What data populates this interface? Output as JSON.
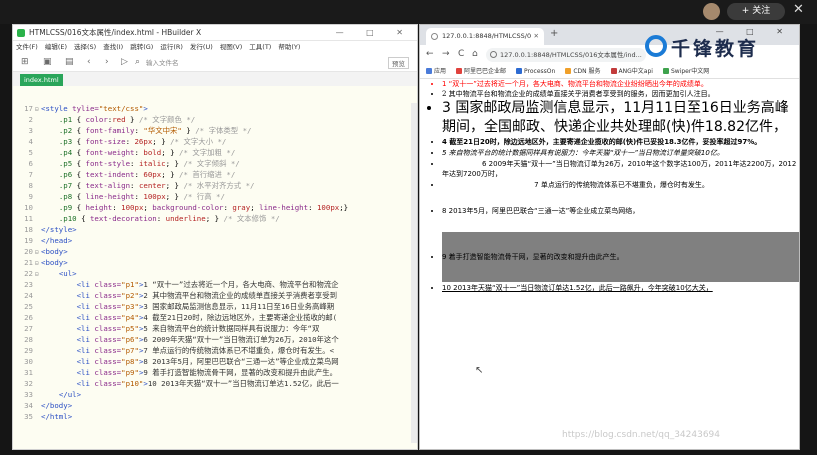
{
  "topbar": {
    "follow_label": "+ 关注",
    "close_glyph": "✕"
  },
  "editor": {
    "title": "HTMLCSS/016文本属性/index.html - HBuilder X",
    "window_controls": "— □ ✕",
    "menu": [
      "文件(F)",
      "编辑(E)",
      "选择(S)",
      "查找(I)",
      "跳转(G)",
      "运行(R)",
      "发行(U)",
      "视图(V)",
      "工具(T)",
      "帮助(Y)"
    ],
    "search_placeholder": "输入文件名",
    "preview_label": "预览",
    "tab": "index.html",
    "lines": [
      {
        "n": "17",
        "fold": "⊟",
        "html": "<span class='tag'>&lt;style</span> <span class='prop'>tylie=</span><span class='str'>\"text/css\"</span><span class='tag'>&gt;</span>"
      },
      {
        "n": "2",
        "fold": "",
        "html": "    <span class='sel'>.p1</span> { <span class='prop'>color</span>:<span class='val'>red</span> } <span class='cm'>/* 文字颜色 */</span>"
      },
      {
        "n": "3",
        "fold": "",
        "html": "    <span class='sel'>.p2</span> { <span class='prop'>font-family</span>: <span class='str'>\"华文中宋\"</span> } <span class='cm'>/* 字体类型 */</span>"
      },
      {
        "n": "4",
        "fold": "",
        "html": "    <span class='sel'>.p3</span> { <span class='prop'>font-size</span>: <span class='val'>26px</span>; } <span class='cm'>/* 文字大小 */</span>"
      },
      {
        "n": "5",
        "fold": "",
        "html": "    <span class='sel'>.p4</span> { <span class='prop'>font-weight</span>: <span class='val'>bold</span>; } <span class='cm'>/* 文字加粗 */</span>"
      },
      {
        "n": "6",
        "fold": "",
        "html": "    <span class='sel'>.p5</span> { <span class='prop'>font-style</span>: <span class='val'>italic</span>; } <span class='cm'>/* 文字倾斜 */</span>"
      },
      {
        "n": "7",
        "fold": "",
        "html": "    <span class='sel'>.p6</span> { <span class='prop'>text-indent</span>: <span class='val'>60px</span>; } <span class='cm'>/* 首行缩进 */</span>"
      },
      {
        "n": "8",
        "fold": "",
        "html": "    <span class='sel'>.p7</span> { <span class='prop'>text-align</span>: <span class='val'>center</span>; } <span class='cm'>/* 水平对齐方式 */</span>"
      },
      {
        "n": "9",
        "fold": "",
        "html": "    <span class='sel'>.p8</span> { <span class='prop'>line-height</span>: <span class='val'>100px</span>; } <span class='cm'>/* 行高 */</span>"
      },
      {
        "n": "10",
        "fold": "",
        "html": "    <span class='sel'>.p9</span> { <span class='prop'>height</span>: <span class='val'>100px</span>; <span class='prop'>background-color</span>: <span class='val'>gray</span>; <span class='prop'>line-height</span>: <span class='val'>100px</span>;}"
      },
      {
        "n": "11",
        "fold": "",
        "html": "    <span class='sel'>.p10</span> { <span class='prop'>text-decoration</span>: <span class='val'>underline</span>; } <span class='cm'>/* 文本修饰 */</span>"
      },
      {
        "n": "18",
        "fold": "",
        "html": "<span class='tag'>&lt;/style&gt;</span>"
      },
      {
        "n": "19",
        "fold": "",
        "html": "<span class='tag'>&lt;/head&gt;</span>"
      },
      {
        "n": "20",
        "fold": "⊟",
        "html": "<span class='tag'>&lt;body&gt;</span>"
      },
      {
        "n": "21",
        "fold": "⊟",
        "html": "<span class='tag'>&lt;body&gt;</span>"
      },
      {
        "n": "22",
        "fold": "⊟",
        "html": "    <span class='tag'>&lt;ul&gt;</span>"
      },
      {
        "n": "23",
        "fold": "",
        "html": "        <span class='tag'>&lt;li</span> <span class='prop'>class=</span><span class='str'>\"p1\"</span><span class='tag'>&gt;</span><span class='txt'>1 “双十一”过去将近一个月，各大电商、物流平台和物流企</span>"
      },
      {
        "n": "24",
        "fold": "",
        "html": "        <span class='tag'>&lt;li</span> <span class='prop'>class=</span><span class='str'>\"p2\"</span><span class='tag'>&gt;</span><span class='txt'>2 其中物流平台和物流企业的成绩单直接关乎消费者享受到</span>"
      },
      {
        "n": "25",
        "fold": "",
        "html": "        <span class='tag'>&lt;li</span> <span class='prop'>class=</span><span class='str'>\"p3\"</span><span class='tag'>&gt;</span><span class='txt'>3 国家邮政局监测信息显示，11月11日至16日业务高峰期</span>"
      },
      {
        "n": "26",
        "fold": "",
        "html": "        <span class='tag'>&lt;li</span> <span class='prop'>class=</span><span class='str'>\"p4\"</span><span class='tag'>&gt;</span><span class='txt'>4 截至21日20时，除边远地区外，主要寄递企业揽收的邮(</span>"
      },
      {
        "n": "27",
        "fold": "",
        "html": "        <span class='tag'>&lt;li</span> <span class='prop'>class=</span><span class='str'>\"p5\"</span><span class='tag'>&gt;</span><span class='txt'>5 来自物流平台的统计数据同样具有说服力：今年“双</span>"
      },
      {
        "n": "28",
        "fold": "",
        "html": "        <span class='tag'>&lt;li</span> <span class='prop'>class=</span><span class='str'>\"p6\"</span><span class='tag'>&gt;</span><span class='txt'>6 2009年天猫“双十一”当日物流订单为26万，2010年这个</span>"
      },
      {
        "n": "29",
        "fold": "",
        "html": "        <span class='tag'>&lt;li</span> <span class='prop'>class=</span><span class='str'>\"p7\"</span><span class='tag'>&gt;</span><span class='txt'>7 单点运行的传统物流体系已不堪重负，爆仓时有发生。&lt;</span>"
      },
      {
        "n": "30",
        "fold": "",
        "html": "        <span class='tag'>&lt;li</span> <span class='prop'>class=</span><span class='str'>\"p8\"</span><span class='tag'>&gt;</span><span class='txt'>8 2013年5月，阿里巴巴联合“三通一达”等企业成立菜鸟网</span>"
      },
      {
        "n": "31",
        "fold": "",
        "html": "        <span class='tag'>&lt;li</span> <span class='prop'>class=</span><span class='str'>\"p9\"</span><span class='tag'>&gt;</span><span class='txt'>9 着手打造智能物流骨干网，显著的改变和提升由此产生。</span>"
      },
      {
        "n": "32",
        "fold": "",
        "html": "        <span class='tag'>&lt;li</span> <span class='prop'>class=</span><span class='str'>\"p10\"</span><span class='tag'>&gt;</span><span class='txt'>10 2013年天猫“双十一”当日物流订单达1.52亿，此后一</span>"
      },
      {
        "n": "33",
        "fold": "",
        "html": "    <span class='tag'>&lt;/ul&gt;</span>"
      },
      {
        "n": "34",
        "fold": "",
        "html": "<span class='tag'>&lt;/body&gt;</span>"
      },
      {
        "n": "35",
        "fold": "",
        "html": "<span class='tag'>&lt;/html&gt;</span>"
      }
    ]
  },
  "browser": {
    "tab_title": "127.0.0.1:8848/HTMLCSS/0",
    "tab_close": "✕",
    "new_tab": "+",
    "window_controls": "— □ ✕",
    "nav": {
      "back": "←",
      "forward": "→",
      "reload": "C",
      "home": "⌂"
    },
    "url": "127.0.0.1:8848/HTMLCSS/016文本属性/ind...",
    "brand": "千锋教育",
    "bookmarks": [
      {
        "label": "应用",
        "color": "#4a7bd9"
      },
      {
        "label": "阿里巴巴企业邮",
        "color": "#e0423d"
      },
      {
        "label": "ProcessOn",
        "color": "#2d6bd2"
      },
      {
        "label": "CDN 服务",
        "color": "#f0a02a"
      },
      {
        "label": "ANG中文api",
        "color": "#c23b3b"
      },
      {
        "label": "Swiper中文网",
        "color": "#3fa34d"
      }
    ],
    "items": [
      "1 “双十一”过去将近一个月，各大电商、物流平台和物流企业纷纷晒出今年的成绩单。",
      "2 其中物流平台和物流企业的成绩单直接关乎消费者享受到的服务，因而更加引人注目。",
      "3 国家邮政局监测信息显示，11月11日至16日业务高峰期间，全国邮政、快递企业共处理邮(快)件18.82亿件，",
      "4 截至21日20时，除边远地区外，主要寄递企业揽收的邮(快)件已妥投18.3亿件，妥投率超过97%。",
      "5 来自物流平台的统计数据同样具有说服力：今年天猫“双十一”当日物流订单量突破10亿。",
      "6 2009年天猫“双十一”当日物流订单为26万，2010年这个数字达100万，2011年达2200万，2012年达到7200万时，",
      "7 单点运行的传统物流体系已不堪重负，爆仓时有发生。",
      "8 2013年5月，阿里巴巴联合“三通一达”等企业成立菜鸟网络，",
      "9 着手打造智能物流骨干网，显著的改变和提升由此产生。",
      "10 2013年天猫“双十一”当日物流订单达1.52亿，此后一路飙升，今年突破10亿大关，"
    ]
  },
  "watermark": "https://blog.csdn.net/qq_34243694"
}
